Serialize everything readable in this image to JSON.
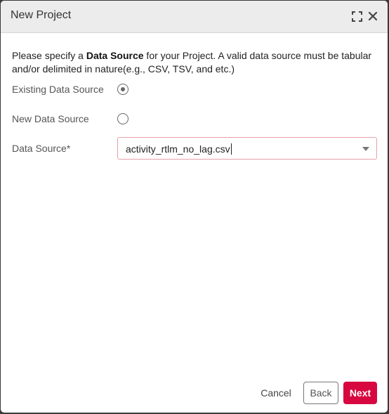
{
  "dialog": {
    "title": "New Project"
  },
  "intro": {
    "prefix": "Please specify a ",
    "emphasis": "Data Source",
    "suffix": " for your Project. A valid data source must be tabular and/or delimited in nature(e.g., CSV, TSV, and etc.)"
  },
  "options": {
    "existing_label": "Existing Data Source",
    "existing_selected": true,
    "new_label": "New Data Source",
    "new_selected": false
  },
  "data_source": {
    "label": "Data Source*",
    "value": "activity_rtlm_no_lag.csv"
  },
  "footer": {
    "cancel_label": "Cancel",
    "back_label": "Back",
    "next_label": "Next"
  },
  "colors": {
    "primary": "#d7083f",
    "field_border": "#e8a0a8",
    "titlebar": "#ececec"
  },
  "icons": {
    "maximize": "maximize-icon",
    "close": "close-icon",
    "dropdown": "chevron-down-icon"
  }
}
